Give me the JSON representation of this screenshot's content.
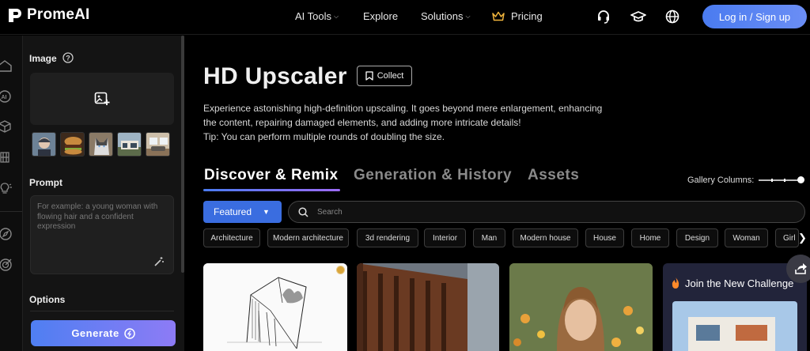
{
  "brand": {
    "name": "PromeAI"
  },
  "nav": {
    "ai_tools": "AI Tools",
    "explore": "Explore",
    "solutions": "Solutions",
    "pricing": "Pricing",
    "login": "Log in / Sign up"
  },
  "sidebar": {
    "image_label": "Image",
    "prompt_label": "Prompt",
    "prompt_placeholder": "For example: a young woman with flowing hair and a confident expression",
    "options_label": "Options",
    "generate_label": "Generate"
  },
  "main": {
    "title": "HD Upscaler",
    "collect_label": "Collect",
    "description": "Experience astonishing high-definition upscaling. It goes beyond mere enlargement, enhancing the content, repairing damaged elements, and adding more intricate details!",
    "tip": "Tip: You can perform multiple rounds of doubling the size."
  },
  "tabs": [
    "Discover & Remix",
    "Generation & History",
    "Assets"
  ],
  "gallery_columns_label": "Gallery Columns:",
  "filter": {
    "featured_label": "Featured",
    "search_placeholder": "Search"
  },
  "chips": [
    "Architecture",
    "Modern architecture",
    "3d rendering",
    "Interior",
    "Man",
    "Modern house",
    "House",
    "Home",
    "Design",
    "Woman",
    "Girl"
  ],
  "challenge": {
    "title": "Join the New Challenge"
  },
  "colors": {
    "accent": "#3a6de0",
    "gradient_start": "#4a7bf0",
    "gradient_end": "#9d6bf7",
    "challenge_bg": "#22243a"
  },
  "icons": {
    "rail": [
      "home-icon",
      "ai-icon",
      "cube-icon",
      "fitting-icon",
      "bulb-icon",
      "compass-icon",
      "target-icon"
    ],
    "header": [
      "headset-icon",
      "graduation-cap-icon",
      "globe-icon"
    ]
  }
}
